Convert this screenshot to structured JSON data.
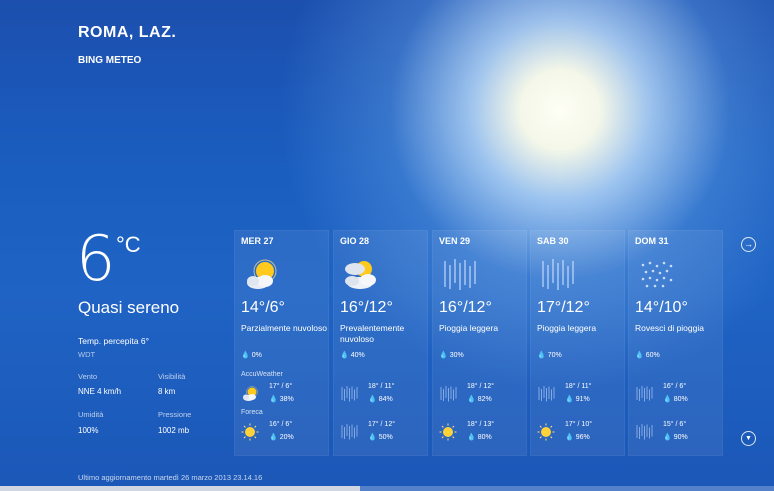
{
  "header": {
    "city": "ROMA, LAZ.",
    "source": "BING METEO"
  },
  "current": {
    "temp": "6",
    "unit": "°C",
    "condition": "Quasi sereno",
    "feels_like": "Temp. percepita 6°",
    "station": "WDT",
    "wind_label": "Vento",
    "wind_value": "NNE 4 km/h",
    "visibility_label": "Visibilità",
    "visibility_value": "8 km",
    "humidity_label": "Umidità",
    "humidity_value": "100%",
    "pressure_label": "Pressione",
    "pressure_value": "1002 mb"
  },
  "providers": {
    "p1": "AccuWeather",
    "p2": "Foreca"
  },
  "days": [
    {
      "name": "MER 27",
      "icon": "partly-cloudy-icon",
      "hl": "14°/6°",
      "desc": "Parzialmente nuvoloso",
      "pop": "0%",
      "p1": {
        "icon": "partly-cloudy-icon",
        "hl": "17° / 6°",
        "pop": "38%"
      },
      "p2": {
        "icon": "sun-icon",
        "hl": "16° / 6°",
        "pop": "20%"
      }
    },
    {
      "name": "GIO 28",
      "icon": "mostly-cloudy-icon",
      "hl": "16°/12°",
      "desc": "Prevalentemente nuvoloso",
      "pop": "40%",
      "p1": {
        "icon": "rain-icon",
        "hl": "18° / 11°",
        "pop": "84%"
      },
      "p2": {
        "icon": "rain-icon",
        "hl": "17° / 12°",
        "pop": "50%"
      }
    },
    {
      "name": "VEN 29",
      "icon": "rain-icon",
      "hl": "16°/12°",
      "desc": "Pioggia leggera",
      "pop": "30%",
      "p1": {
        "icon": "rain-icon",
        "hl": "18° / 12°",
        "pop": "82%"
      },
      "p2": {
        "icon": "sun-icon",
        "hl": "18° / 13°",
        "pop": "80%"
      }
    },
    {
      "name": "SAB 30",
      "icon": "rain-icon",
      "hl": "17°/12°",
      "desc": "Pioggia leggera",
      "pop": "70%",
      "p1": {
        "icon": "rain-icon",
        "hl": "18° / 11°",
        "pop": "91%"
      },
      "p2": {
        "icon": "sun-icon",
        "hl": "17° / 10°",
        "pop": "96%"
      }
    },
    {
      "name": "DOM 31",
      "icon": "showers-icon",
      "hl": "14°/10°",
      "desc": "Rovesci di pioggia",
      "pop": "60%",
      "p1": {
        "icon": "rain-icon",
        "hl": "16° / 6°",
        "pop": "80%"
      },
      "p2": {
        "icon": "rain-icon",
        "hl": "15° / 6°",
        "pop": "90%"
      }
    }
  ],
  "footer": {
    "updated": "Ultimo aggiornamento martedì 26 marzo 2013 23.14.16"
  },
  "nav": {
    "next": "→",
    "down": "▼"
  },
  "glyphs": {
    "drop": "💧"
  }
}
